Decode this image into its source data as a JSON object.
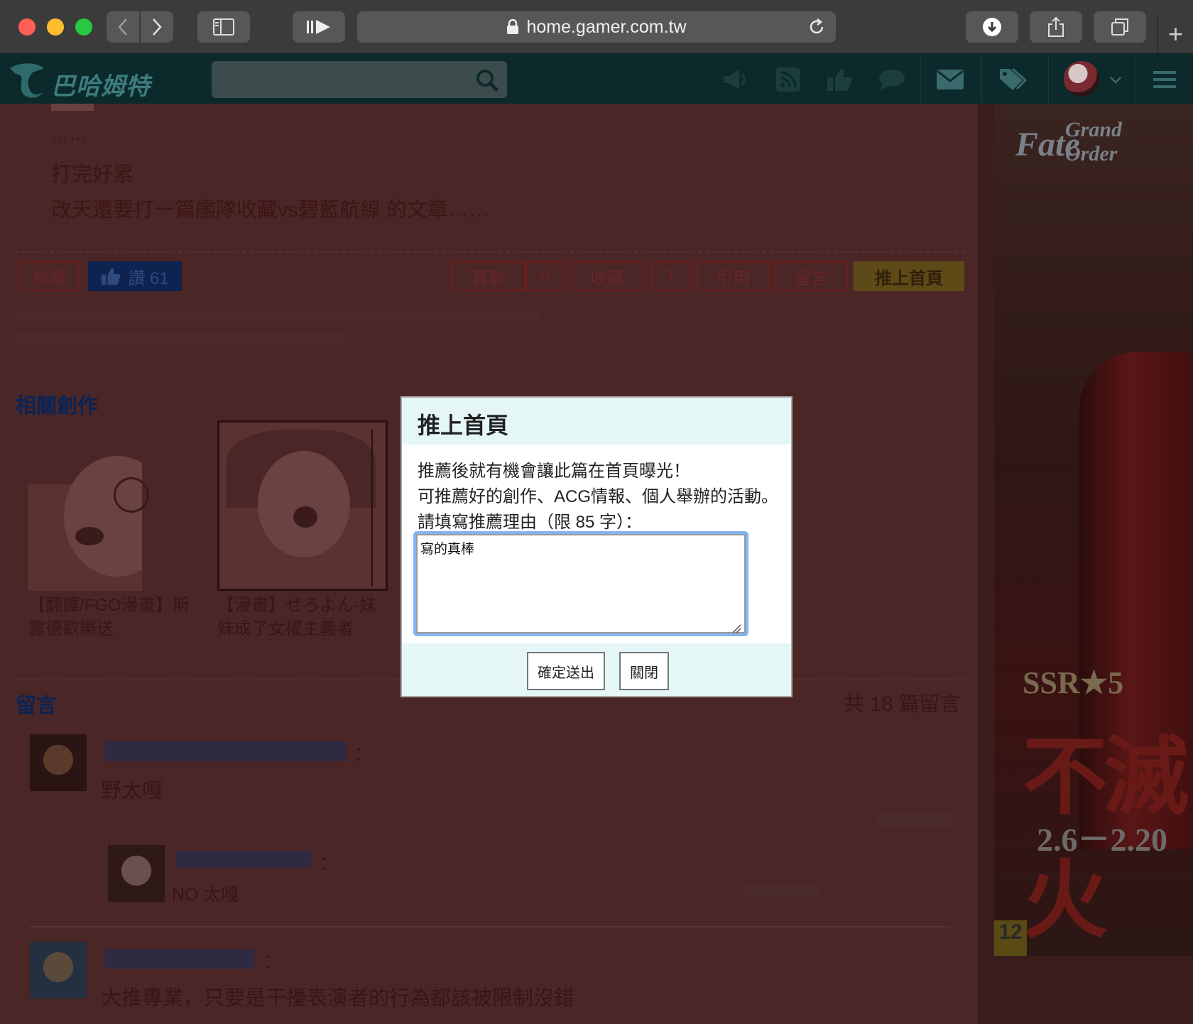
{
  "browser": {
    "url": "home.gamer.com.tw",
    "new_tab_symbol": "+"
  },
  "site": {
    "logo_text": "巴哈姆特",
    "search_placeholder": ""
  },
  "article": {
    "dots": "……",
    "line1": "打完好累",
    "line2": "改天還要打一篇艦隊收藏vs碧藍航線 的文章……"
  },
  "actions": {
    "report": "檢舉",
    "like": "讚 61",
    "favorite": "喜歡",
    "favorite_count": "9",
    "collect": "收藏",
    "collect_count": "1",
    "quote": "引用",
    "comment": "留言",
    "push": "推上首頁"
  },
  "related": {
    "title": "相關創作",
    "items": [
      {
        "caption": "【翻譯/FGO漫畫】斯露德歡樂送"
      },
      {
        "caption": "【漫畫】ぜろよん-妹妹成了女權主義者"
      }
    ]
  },
  "comments": {
    "title": "留言",
    "count_text": "共 18 篇留言",
    "list": [
      {
        "body": "野太嘎"
      },
      {
        "body": "NO 太嘎"
      },
      {
        "body": "大推專業，只要是干擾表演者的行為都該被限制沒錯"
      }
    ]
  },
  "ad": {
    "logo": "Fate",
    "logo_sub": "Grand Order",
    "badge": "SSR★5",
    "title": "不滅火",
    "dates": "2.6－2.20",
    "age": "12"
  },
  "modal": {
    "title": "推上首頁",
    "desc1": "推薦後就有機會讓此篇在首頁曝光！",
    "desc2": "可推薦好的創作、ACG情報、個人舉辦的活動。",
    "desc3": "請填寫推薦理由（限 85 字）：",
    "reason_value": "寫的真棒",
    "submit": "確定送出",
    "close": "關閉"
  },
  "colors": {
    "overlay": "#4a2626",
    "modal_header": "#e5f6f6",
    "focus_ring": "#84b4ef"
  }
}
